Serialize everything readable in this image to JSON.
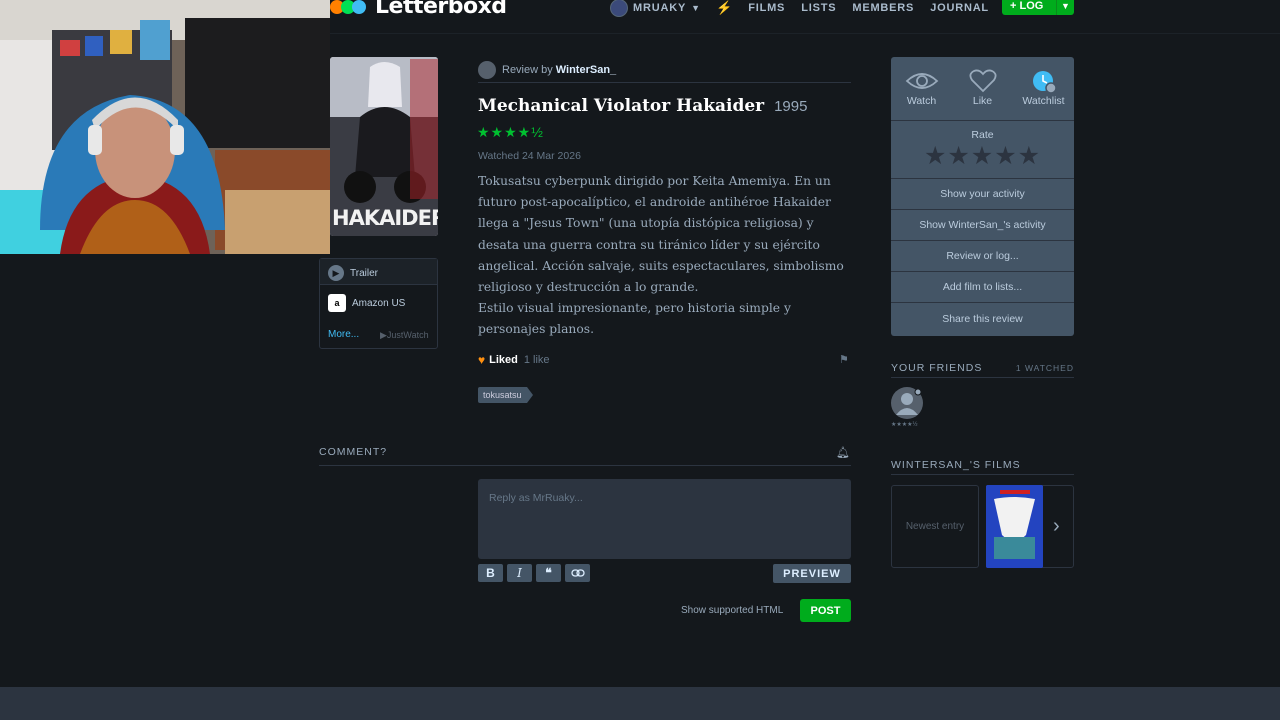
{
  "header": {
    "logo_text": "Letterboxd",
    "logo_colors": [
      "#ff8000",
      "#00e054",
      "#40bcf4"
    ],
    "nav": {
      "user": "MRUAKY",
      "films": "FILMS",
      "lists": "LISTS",
      "members": "MEMBERS",
      "journal": "JOURNAL"
    },
    "log_button": "+ LOG"
  },
  "poster": {
    "title_art": "HAKAIDER"
  },
  "watch_options": {
    "trailer": "Trailer",
    "amazon": "Amazon US",
    "more": "More...",
    "justwatch": "▶JustWatch"
  },
  "review": {
    "by_prefix": "Review by",
    "author": "WinterSan_",
    "film_title": "Mechanical Violator Hakaider",
    "year": "1995",
    "rating_stars": "★★★★½",
    "rating_value": 4.5,
    "watched": "Watched 24 Mar 2026",
    "paragraphs": [
      "Tokusatsu cyberpunk dirigido por Keita Amemiya. En un futuro post-apocalíptico, el androide antihéroe Hakaider llega a \"Jesus Town\" (una utopía distópica religiosa) y desata una guerra contra su tiránico líder y su ejército angelical. Acción salvaje, suits espectaculares, simbolismo religioso y destrucción a lo grande.",
      "Estilo visual impresionante, pero historia simple y personajes planos."
    ],
    "liked": "Liked",
    "likes_count": "1 like",
    "tag": "tokusatsu"
  },
  "comments": {
    "header": "COMMENT?",
    "placeholder": "Reply as MrRuaky...",
    "preview": "PREVIEW",
    "supported_html": "Show supported HTML",
    "post": "POST"
  },
  "sidebar": {
    "actions": {
      "watch": "Watch",
      "like": "Like",
      "watchlist": "Watchlist",
      "rate": "Rate",
      "rows": [
        "Show your activity",
        "Show WinterSan_'s activity",
        "Review or log...",
        "Add film to lists...",
        "Share this review"
      ]
    },
    "friends": {
      "header": "YOUR FRIENDS",
      "count": "1 WATCHED",
      "friend_rating": "★★★★½"
    },
    "films": {
      "header": "WINTERSAN_'S FILMS",
      "newest": "Newest entry"
    }
  },
  "colors": {
    "background": "#14181c",
    "accent_green": "#00ac1c",
    "liked_orange": "#ff9010",
    "watchlist_blue": "#40bcf4"
  }
}
